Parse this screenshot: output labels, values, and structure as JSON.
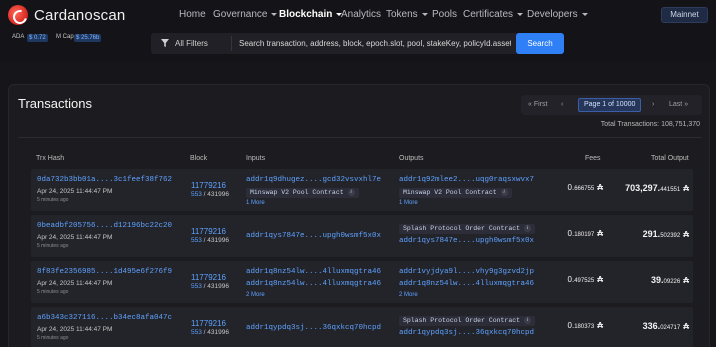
{
  "brand": {
    "name": "Cardanoscan"
  },
  "nav": {
    "items": [
      {
        "label": "Home",
        "dropdown": false
      },
      {
        "label": "Governance",
        "dropdown": true
      },
      {
        "label": "Blockchain",
        "dropdown": true,
        "active": true
      },
      {
        "label": "Analytics",
        "dropdown": false
      },
      {
        "label": "Tokens",
        "dropdown": true
      },
      {
        "label": "Pools",
        "dropdown": false
      },
      {
        "label": "Certificates",
        "dropdown": true
      },
      {
        "label": "Developers",
        "dropdown": true
      }
    ],
    "network": "Mainnet"
  },
  "ticker": {
    "ada_label": "ADA",
    "ada_price": "$ 0.72",
    "mcap_label": "M Cap",
    "mcap_value": "$ 25.76b"
  },
  "search": {
    "filter_label": "All Filters",
    "placeholder": "Search transaction, address, block, epoch.slot, pool, stakeKey, policyId.assetName",
    "button_label": "Search"
  },
  "page": {
    "title": "Transactions",
    "pager": {
      "first": "First",
      "current": "Page 1 of 10000",
      "last": "Last"
    },
    "total": "Total Transactions: 108,751,370"
  },
  "table": {
    "columns": [
      "Trx Hash",
      "Block",
      "Inputs",
      "Outputs",
      "Fees",
      "Total Output"
    ],
    "rows": [
      {
        "hash": "0da732b3bb01a....3c1feef38f762",
        "date": "Apr 24, 2025 11:44:47 PM",
        "ago": "5 minutes ago",
        "block": "11779216",
        "epoch": "553",
        "slot": "431996",
        "inputs": [
          "addr1q9dhugez....gcd32vsvxhl7e"
        ],
        "input_tags": [
          "Minswap V2 Pool Contract"
        ],
        "input_more": "1 More",
        "outputs": [
          "addr1q92mlee2....uqg0raqsxwvx7"
        ],
        "output_tags": [
          "Minswap V2 Pool Contract"
        ],
        "output_more": "1 More",
        "fee_int": "0.",
        "fee_dec": "666755",
        "out_int": "703,297.",
        "out_dec": "441551"
      },
      {
        "hash": "0beadbf205756....d12196bc22c20",
        "date": "Apr 24, 2025 11:44:47 PM",
        "ago": "5 minutes ago",
        "block": "11779216",
        "epoch": "553",
        "slot": "431996",
        "inputs": [
          "addr1qys7847e....upgh0wsmf5x0x"
        ],
        "input_tags": [],
        "input_more": "",
        "outputs": [
          "addr1qys7847e....upgh0wsmf5x0x"
        ],
        "output_tags": [
          "Splash Protocol Order Contract"
        ],
        "output_more": "",
        "fee_int": "0.",
        "fee_dec": "180197",
        "out_int": "291.",
        "out_dec": "502392"
      },
      {
        "hash": "8f83fe2356985....1d495e6f276f9",
        "date": "Apr 24, 2025 11:44:47 PM",
        "ago": "5 minutes ago",
        "block": "11779216",
        "epoch": "553",
        "slot": "431996",
        "inputs": [
          "addr1q8nz54lw....4lluxmqgtra46",
          "addr1q8nz54lw....4lluxmqgtra46"
        ],
        "input_tags": [],
        "input_more": "2 More",
        "outputs": [
          "addr1vyjdya9l....vhy9g3gzvd2jp",
          "addr1q8nz54lw....4lluxmqgtra46"
        ],
        "output_tags": [],
        "output_more": "2 More",
        "fee_int": "0.",
        "fee_dec": "497525",
        "out_int": "39.",
        "out_dec": "09226"
      },
      {
        "hash": "a6b343c327116....b34ec8afa047c",
        "date": "Apr 24, 2025 11:44:47 PM",
        "ago": "5 minutes ago",
        "block": "11779216",
        "epoch": "553",
        "slot": "431996",
        "inputs": [
          "addr1qypdq3sj....36qxkcq70hcpd"
        ],
        "input_tags": [],
        "input_more": "",
        "outputs": [
          "addr1qypdq3sj....36qxkcq70hcpd"
        ],
        "output_tags": [
          "Splash Protocol Order Contract"
        ],
        "output_more": "",
        "fee_int": "0.",
        "fee_dec": "180373",
        "out_int": "336.",
        "out_dec": "024717"
      }
    ]
  }
}
